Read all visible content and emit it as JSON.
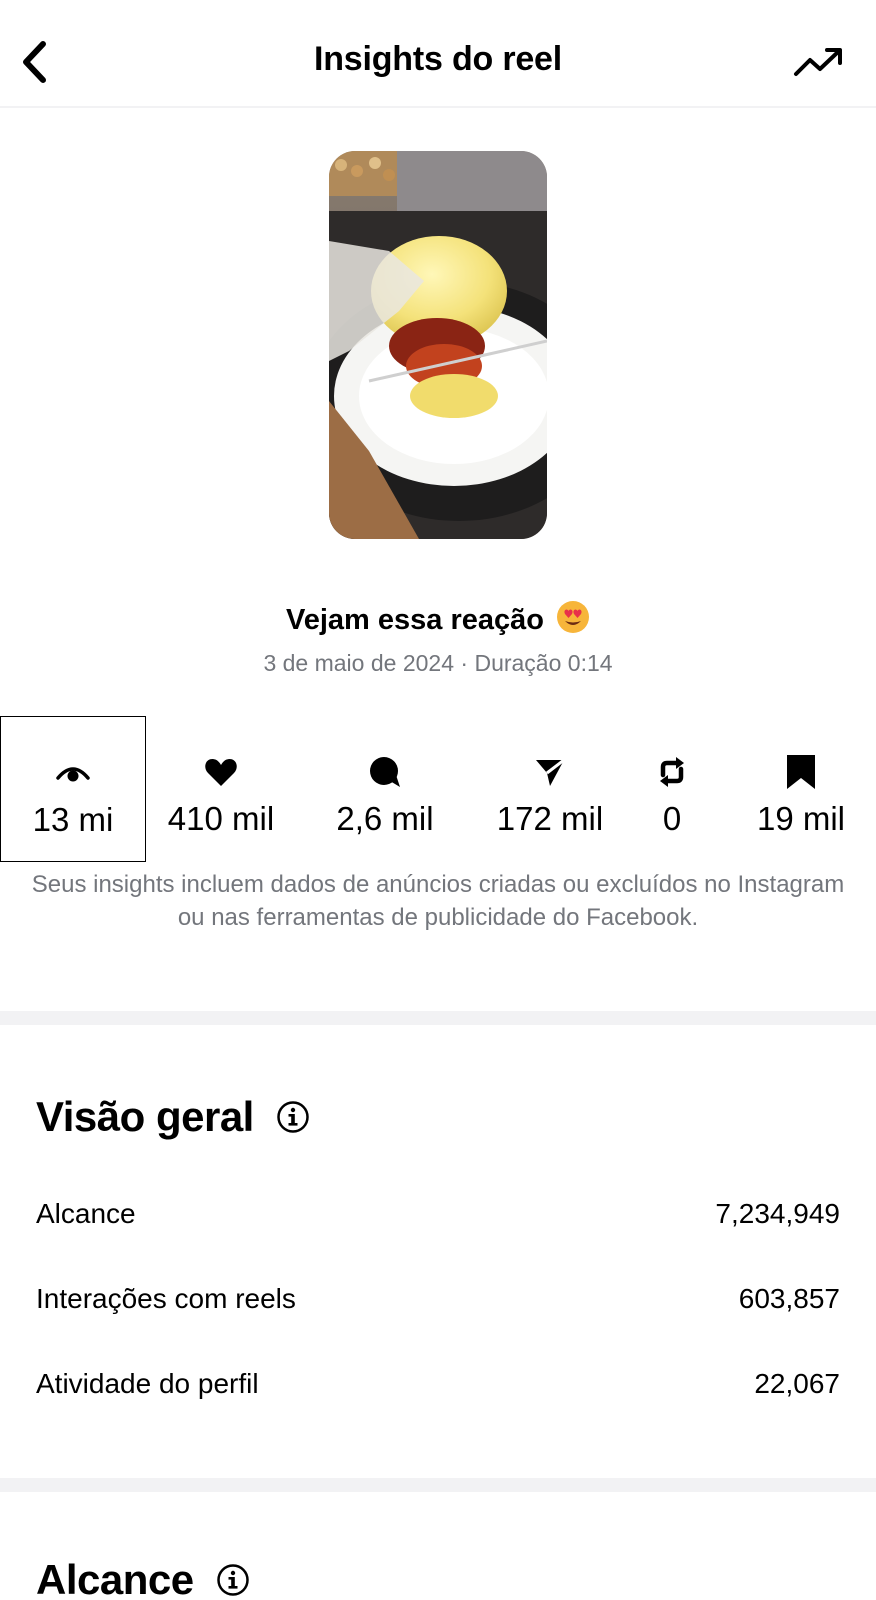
{
  "header": {
    "title": "Insights do reel",
    "back_icon": "chevron-left-icon",
    "trend_icon": "trend-up-icon"
  },
  "reel": {
    "caption": "Vejam essa reação",
    "caption_emoji": "smiling-face-heart-eyes",
    "date": "3 de maio de 2024",
    "separator": " · ",
    "duration": "Duração 0:14"
  },
  "stats": [
    {
      "icon": "eye-icon",
      "value": "13 mi"
    },
    {
      "icon": "heart-icon",
      "value": "410 mil"
    },
    {
      "icon": "comment-icon",
      "value": "2,6 mil"
    },
    {
      "icon": "send-icon",
      "value": "172 mil"
    },
    {
      "icon": "repost-icon",
      "value": "0"
    },
    {
      "icon": "bookmark-icon",
      "value": "19 mil"
    }
  ],
  "disclaimer": "Seus insights incluem dados de anúncios criadas ou excluídos no Instagram ou nas ferramentas de publicidade do Facebook.",
  "overview": {
    "title": "Visão geral",
    "rows": [
      {
        "label": "Alcance",
        "value": "7,234,949"
      },
      {
        "label": "Interações com reels",
        "value": "603,857"
      },
      {
        "label": "Atividade do perfil",
        "value": "22,067"
      }
    ]
  },
  "reach": {
    "title": "Alcance"
  },
  "colors": {
    "muted_text": "#73767c",
    "divider": "#f2f2f4",
    "emoji_face": "#f7b53a",
    "emoji_hearts": "#e8304a"
  }
}
